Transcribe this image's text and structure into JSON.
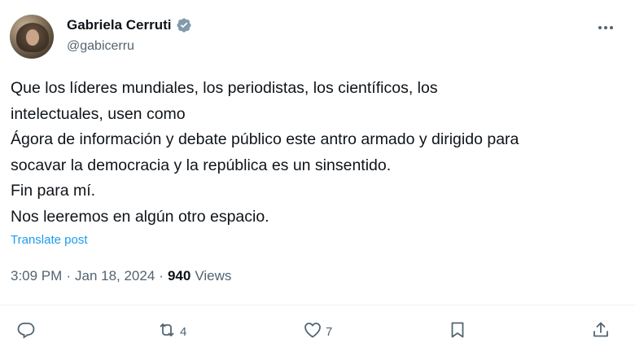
{
  "author": {
    "display_name": "Gabriela Cerruti",
    "handle": "@gabicerru"
  },
  "icons": {
    "verified": "verified-badge-icon",
    "more": "more-options-icon",
    "reply": "reply-icon",
    "retweet": "retweet-icon",
    "like": "like-icon",
    "bookmark": "bookmark-icon",
    "share": "share-icon"
  },
  "colors": {
    "link": "#1d9bf0",
    "secondary_text": "#536471",
    "primary_text": "#0f1419"
  },
  "tweet": {
    "lines": [
      "Que los líderes mundiales, los periodistas, los científicos, los",
      "intelectuales, usen como",
      "Ágora de información y debate público este antro armado y dirigido para",
      "socavar la democracia y la república es un sinsentido.",
      "Fin para mí.",
      "Nos leeremos en algún otro espacio."
    ],
    "translate_label": "Translate post",
    "time": "3:09 PM",
    "dot": "·",
    "date": "Jan 18, 2024",
    "views_count": "940",
    "views_label": "Views"
  },
  "actions": {
    "replies": "",
    "retweets": "4",
    "likes": "7"
  }
}
